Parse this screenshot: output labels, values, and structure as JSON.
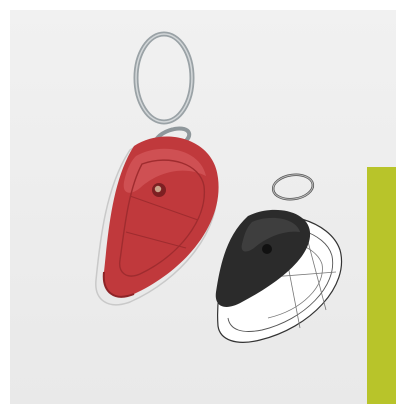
{
  "colors": {
    "background": "#ececec",
    "accent": "#b8c42a",
    "red_shell": "#c0393c",
    "black_shell": "#2b2b2b",
    "metal_ring": "#8f979b"
  },
  "objects": {
    "front_tag": {
      "shell_color": "red",
      "icon": "keyfinder-tag-red"
    },
    "back_tag": {
      "shell_color": "black",
      "icon": "keyfinder-tag-black-wireframe"
    }
  }
}
